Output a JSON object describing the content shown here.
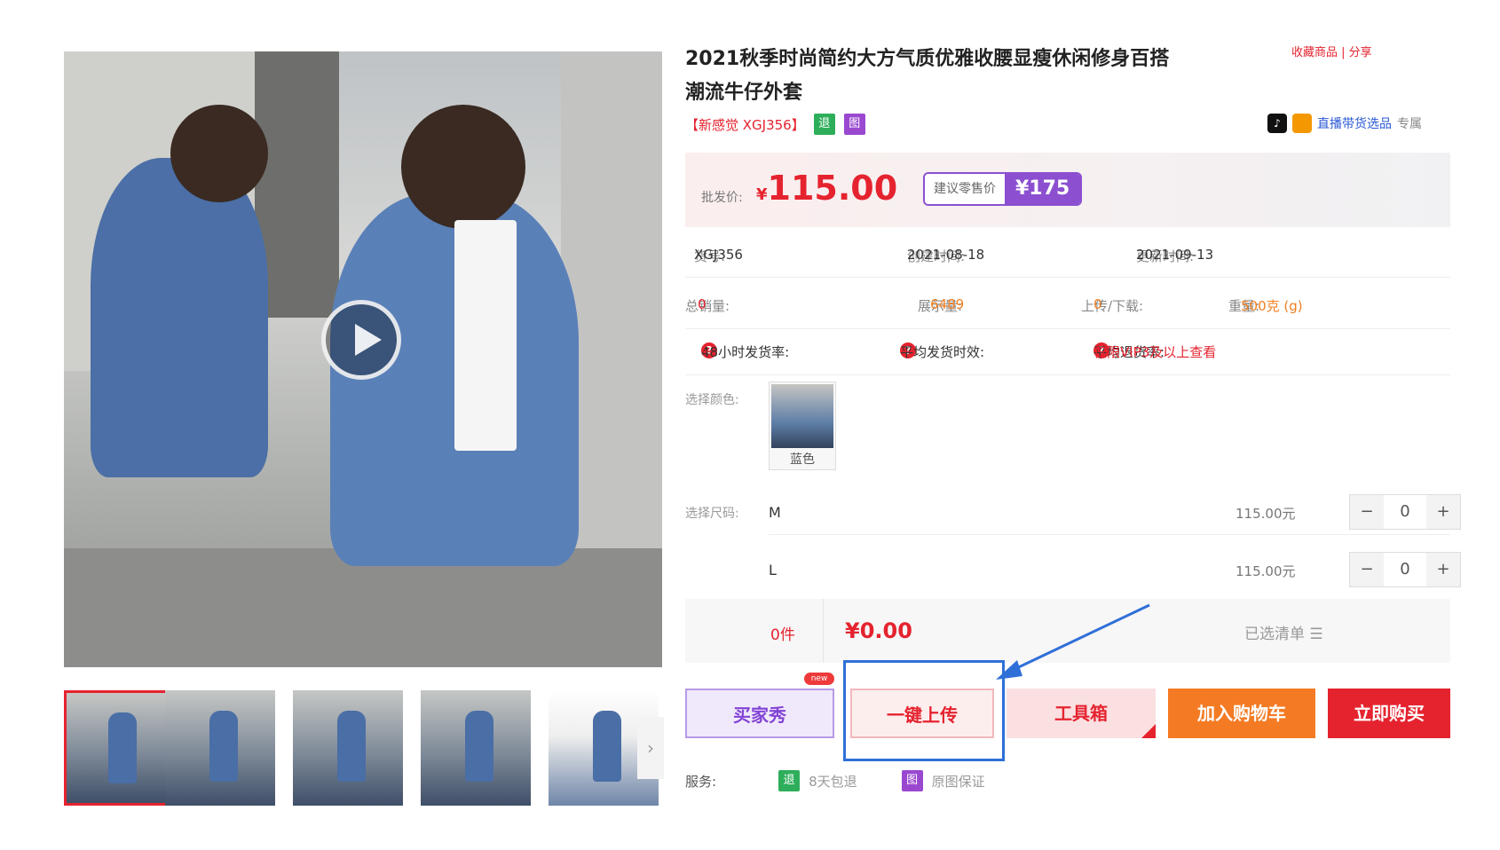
{
  "product": {
    "title": "2021秋季时尚简约大方气质优雅收腰显瘦休闲修身百搭潮流牛仔外套",
    "tag": "【新感觉 XGJ356】",
    "badges": [
      "退",
      "图"
    ],
    "top_links": "收藏商品  |  分享"
  },
  "live": {
    "label": "直播带货选品",
    "suffix": "专属"
  },
  "price": {
    "wholesale_label": "批发价:",
    "currency": "¥",
    "wholesale_value": "115.00",
    "retail_label": "建议零售价",
    "retail_value": "¥175"
  },
  "info": {
    "sku_label": "货号:",
    "sku": "XGJ356",
    "created_label": "创建时间:",
    "created": "2021-08-18",
    "updated_label": "更新时间:",
    "updated": "2021-09-13",
    "sales_label": "总销量:",
    "sales": "0",
    "views_label": "展示量:",
    "views": "6489",
    "uploads_label": "上传/下载:",
    "uploads": "0",
    "weight_label": "重量:",
    "weight": "500克 (g)"
  },
  "metrics": {
    "ship48_label": "48小时发货率:",
    "ship48_value": "--",
    "avg_ship_label": "平均发货时效:",
    "avg_ship_value": "--",
    "refund_label": "平均退货率:",
    "refund_value": "仅限VIP3及以上查看"
  },
  "color": {
    "label": "选择颜色:",
    "option": "蓝色"
  },
  "sizes": {
    "label": "选择尺码:",
    "rows": [
      {
        "size": "M",
        "price": "115.00元",
        "qty": "0"
      },
      {
        "size": "L",
        "price": "115.00元",
        "qty": "0"
      }
    ]
  },
  "summary": {
    "count": "0件",
    "total": "¥0.00",
    "selected": "已选清单"
  },
  "buttons": {
    "buyer_show": "买家秀",
    "new_tag": "new",
    "upload": "一键上传",
    "toolbox": "工具箱",
    "add_cart": "加入购物车",
    "buy_now": "立即购买"
  },
  "service": {
    "label": "服务:",
    "items": [
      {
        "badge": "退",
        "text": "8天包退"
      },
      {
        "badge": "图",
        "text": "原图保证"
      }
    ]
  },
  "colors": {
    "accent_red": "#e5232f",
    "purple": "#8b4fd0",
    "orange": "#f47b24",
    "highlight_blue": "#2f6fd8"
  }
}
